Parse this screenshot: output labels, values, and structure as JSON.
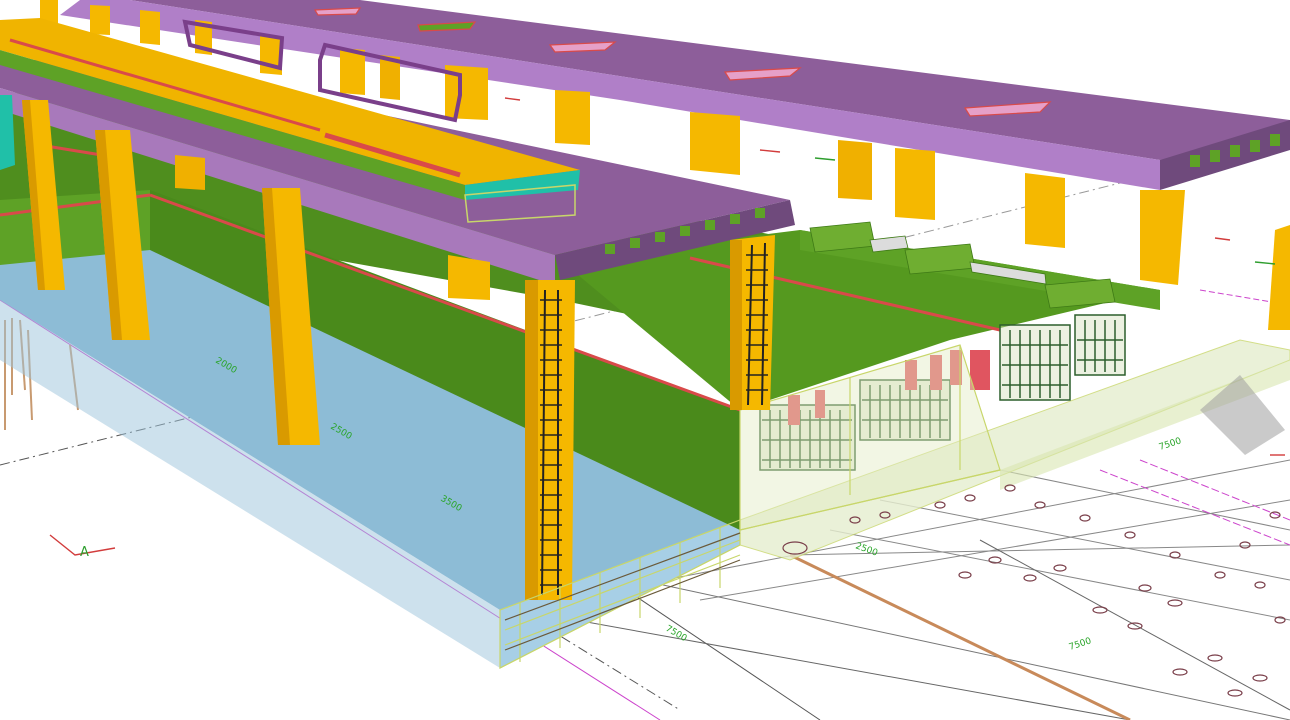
{
  "viewport": {
    "name": "3D model view",
    "background": "#ffffff"
  },
  "axis_indicator": {
    "label": "A",
    "color": "#d23c3c",
    "label_color": "#2e9e2e"
  },
  "dimension_labels": [
    "3500",
    "7500",
    "2000",
    "2500",
    "2500",
    "7500",
    "7500"
  ],
  "colors": {
    "column": "#f5b800",
    "column_side": "#d99a00",
    "deck_top": "#8d5e9a",
    "deck_side": "#b07fc8",
    "wall": "#4f8e1e",
    "wall_light": "#5ea226",
    "floor": "#8dbcd6",
    "beam": "#f0b400",
    "red_stripe": "#d94a4a",
    "teal": "#20c0a8",
    "rebar_cage": "#2c5e2c",
    "grid_line": "#555555",
    "magenta_line": "#cc44cc",
    "brown_pipe": "#c88a5a"
  }
}
